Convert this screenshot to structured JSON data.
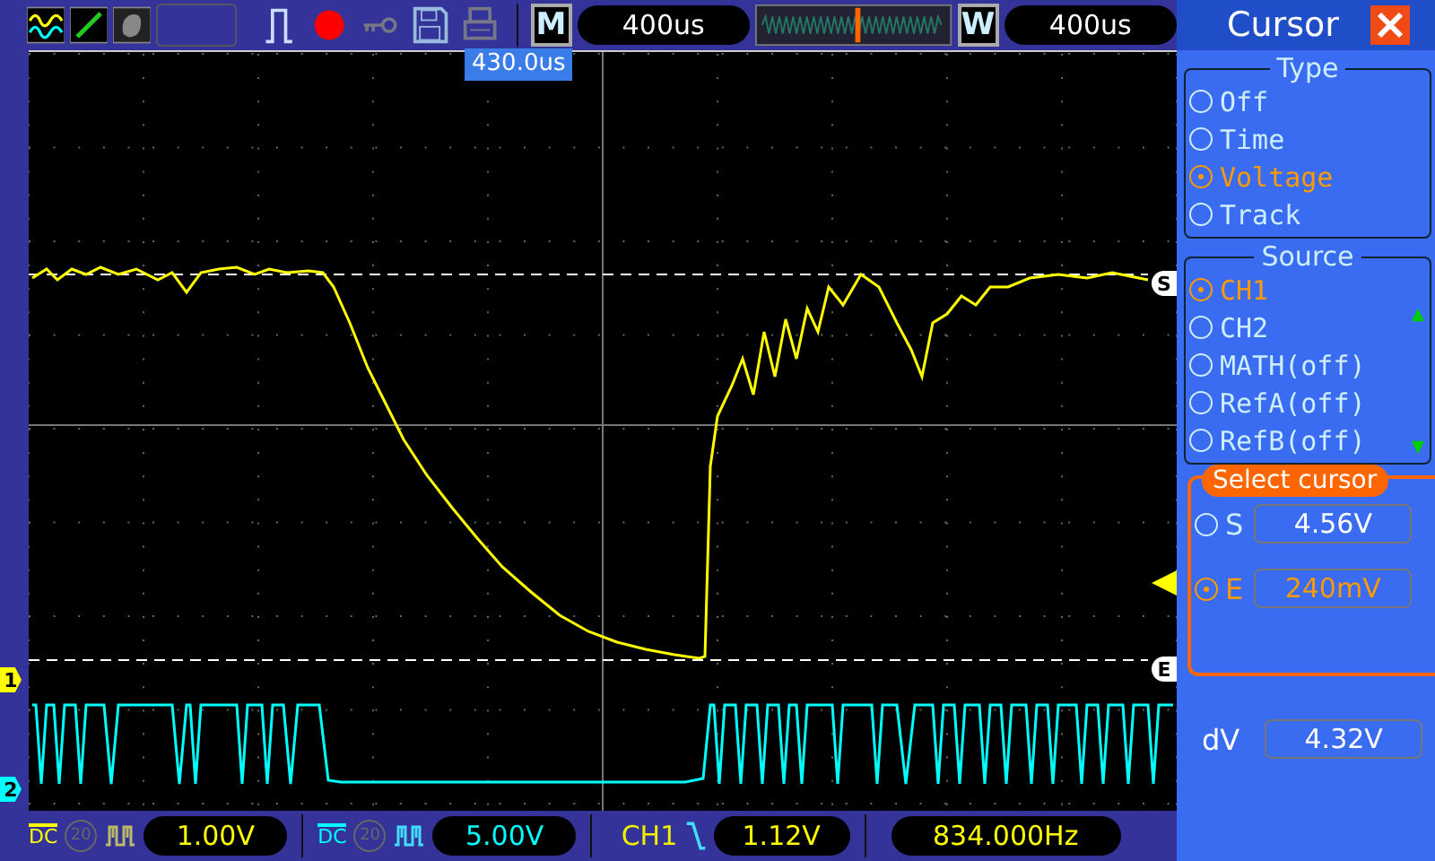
{
  "top_bar": {
    "timebase_label": "M",
    "timebase": "400us",
    "window_label": "W",
    "window_timebase": "400us"
  },
  "display": {
    "trigger_time": "430.0us",
    "channel_markers": [
      {
        "label": "1",
        "color": "#ffff00"
      },
      {
        "label": "2",
        "color": "#00ffff"
      }
    ],
    "cursor_markers": [
      {
        "label": "S"
      },
      {
        "label": "E"
      }
    ]
  },
  "cursor_panel": {
    "title": "Cursor",
    "type_label": "Type",
    "type_options": [
      {
        "label": "Off",
        "selected": false
      },
      {
        "label": "Time",
        "selected": false
      },
      {
        "label": "Voltage",
        "selected": true
      },
      {
        "label": "Track",
        "selected": false
      }
    ],
    "source_label": "Source",
    "source_options": [
      {
        "label": "CH1",
        "selected": true
      },
      {
        "label": "CH2",
        "selected": false
      },
      {
        "label": "MATH(off)",
        "selected": false
      },
      {
        "label": "RefA(off)",
        "selected": false
      },
      {
        "label": "RefB(off)",
        "selected": false
      }
    ],
    "select_label": "Select cursor",
    "cursors": [
      {
        "label": "S",
        "value": "4.56V",
        "selected": false
      },
      {
        "label": "E",
        "value": "240mV",
        "selected": true
      }
    ],
    "delta": {
      "label": "dV",
      "value": "4.32V"
    }
  },
  "status_bar": {
    "channels": [
      {
        "coupling": "DC",
        "bandwidth": "20",
        "scale": "1.00V",
        "color": "#ffff00"
      },
      {
        "coupling": "DC",
        "bandwidth": "20",
        "scale": "5.00V",
        "color": "#00ffff"
      }
    ],
    "trigger_source": "CH1",
    "trigger_level": "1.12V",
    "frequency": "834.000Hz"
  }
}
